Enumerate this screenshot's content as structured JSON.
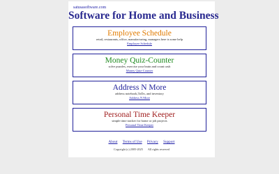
{
  "site": {
    "domain": "satusasoftware.com",
    "title": "Software for Home and Business"
  },
  "colors": {
    "accent": "#1f1f99"
  },
  "products": [
    {
      "title": "Employee Schedule",
      "color": "#e07a00",
      "description": "retail, restaurants, office, manufacturing, managers here is some help",
      "link": "Employee Schedule"
    },
    {
      "title": "Money Quiz-Counter",
      "color": "#1e8a1e",
      "description": "solve puzzles, exercise your brain and count cash",
      "link": "Money Quiz-Counter"
    },
    {
      "title": "Address N More",
      "color": "#1f1f99",
      "description": "address notebook,ToDo, and inventory",
      "link": "Address N More"
    },
    {
      "title": "Personal Time Keeper",
      "color": "#a02020",
      "description": "simple time tracker for home or job projects",
      "link": "Personal Time Keeper"
    }
  ],
  "footer": {
    "links": [
      "About",
      "Terms of Use",
      "Privacy",
      "Support"
    ],
    "copyright": "Copyright (c) 2005-2025",
    "rights": "All rights reserved"
  }
}
